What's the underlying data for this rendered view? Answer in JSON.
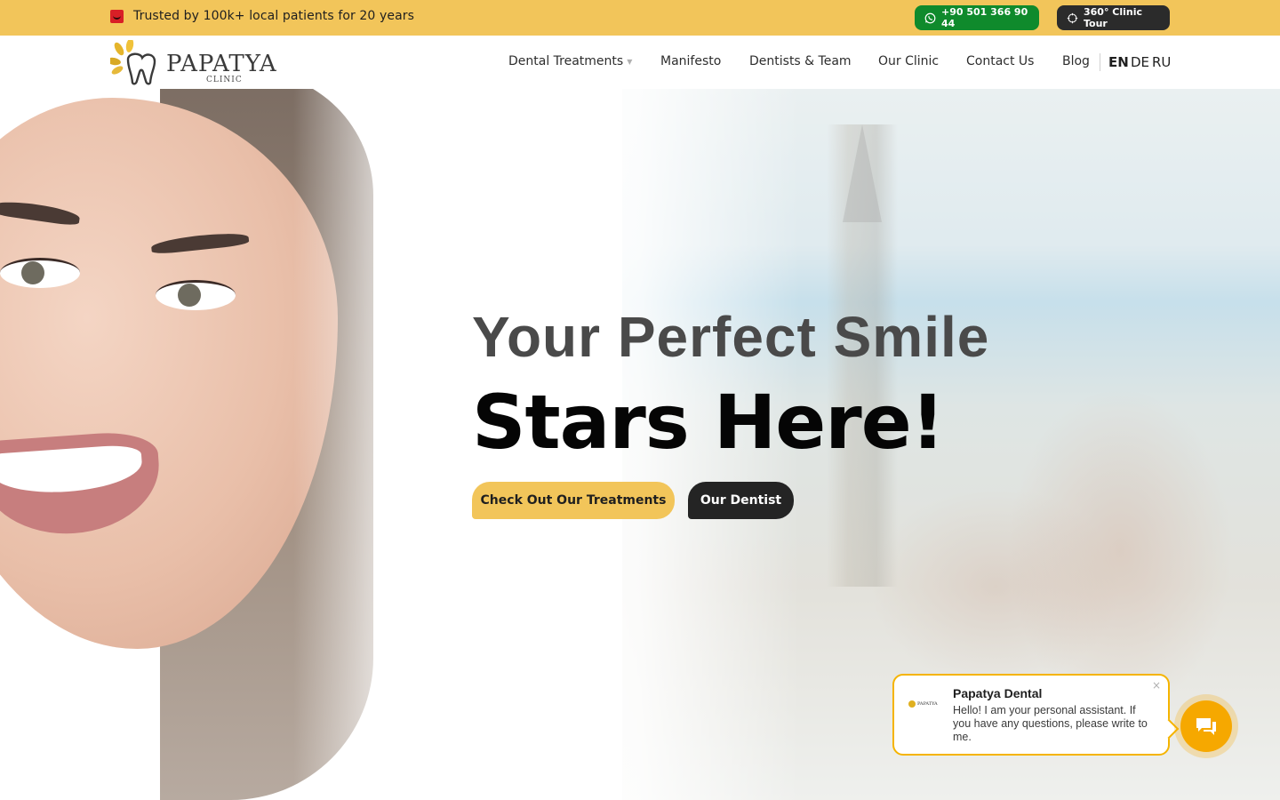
{
  "topbar": {
    "trust_text": "Trusted by 100k+ local patients for 20 years",
    "whatsapp_label": "+90 501 366 90 44",
    "tour_label": "360° Clinic Tour"
  },
  "brand": {
    "name": "PAPATYA",
    "sub": "CLINIC"
  },
  "nav": {
    "items": [
      {
        "label": "Dental Treatments"
      },
      {
        "label": "Manifesto"
      },
      {
        "label": "Dentists & Team"
      },
      {
        "label": "Our Clinic"
      },
      {
        "label": "Contact Us"
      },
      {
        "label": "Blog"
      }
    ],
    "languages": [
      "EN",
      "DE",
      "RU"
    ],
    "active_language": "EN"
  },
  "hero": {
    "line1": "Your Perfect Smile",
    "line2": "Stars Here!",
    "cta_primary": "Check Out Our Treatments",
    "cta_secondary": "Our Dentist"
  },
  "chat": {
    "title": "Papatya Dental",
    "message": "Hello! I am your personal assistant. If you have any questions, please write to me.",
    "close": "×"
  },
  "colors": {
    "accent_yellow": "#f2c55a",
    "whatsapp_green": "#0f8a2c",
    "dark": "#242424",
    "chat_orange": "#f6a800"
  }
}
